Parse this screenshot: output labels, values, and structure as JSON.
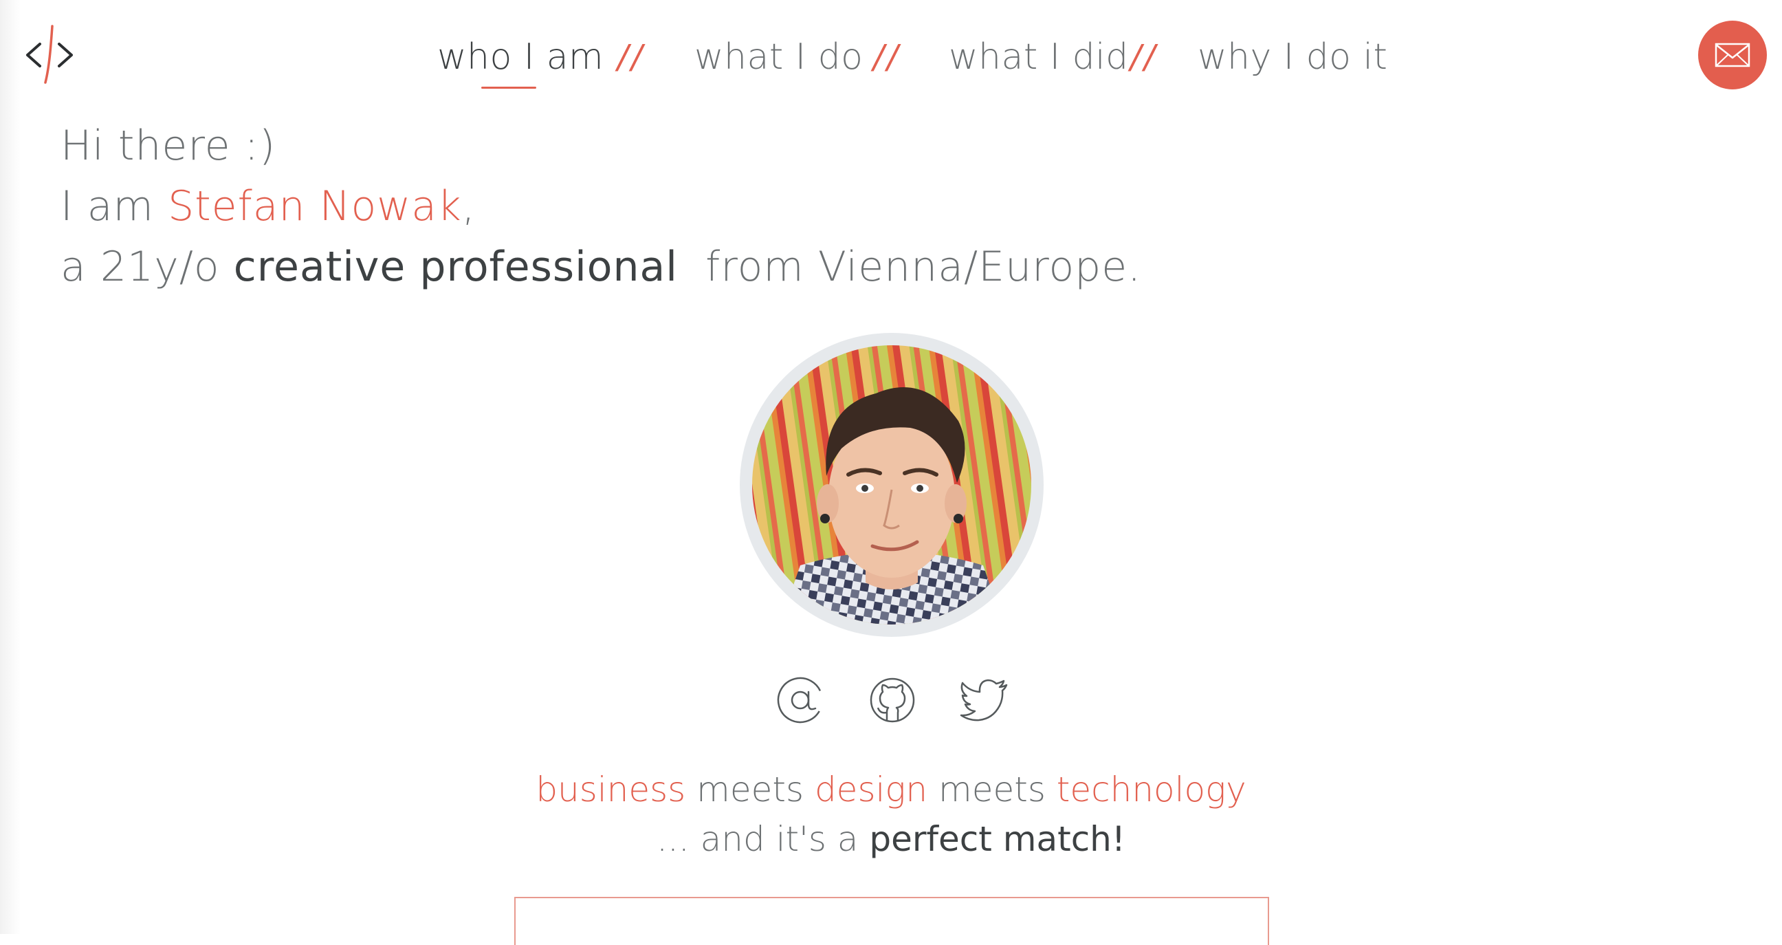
{
  "nav": {
    "items": [
      {
        "label": "who I am",
        "active": true
      },
      {
        "label": "what I do",
        "active": false
      },
      {
        "label": "what I did",
        "active": false
      },
      {
        "label": "why I do it",
        "active": false
      }
    ],
    "separator": "//"
  },
  "intro": {
    "greeting": "Hi there :)",
    "i_am": "I am",
    "name": "Stefan Nowak",
    "name_suffix": ",",
    "age_prefix": "a 21y/o",
    "role": "creative professional",
    "location": "from Vienna/Europe."
  },
  "tagline": {
    "business": "business",
    "meets1": "meets",
    "design": "design",
    "meets2": "meets",
    "technology": "technology",
    "second_prefix": "... and it's a",
    "second_strong": "perfect match!"
  },
  "icons": {
    "logo": "code-brackets-logo",
    "mail": "envelope-icon",
    "email": "at-icon",
    "github": "github-icon",
    "twitter": "twitter-bird-icon"
  },
  "colors": {
    "accent": "#e2604f",
    "text": "#6d7173",
    "text_strong": "#3d4143",
    "avatar_ring": "#e6e9ec"
  }
}
